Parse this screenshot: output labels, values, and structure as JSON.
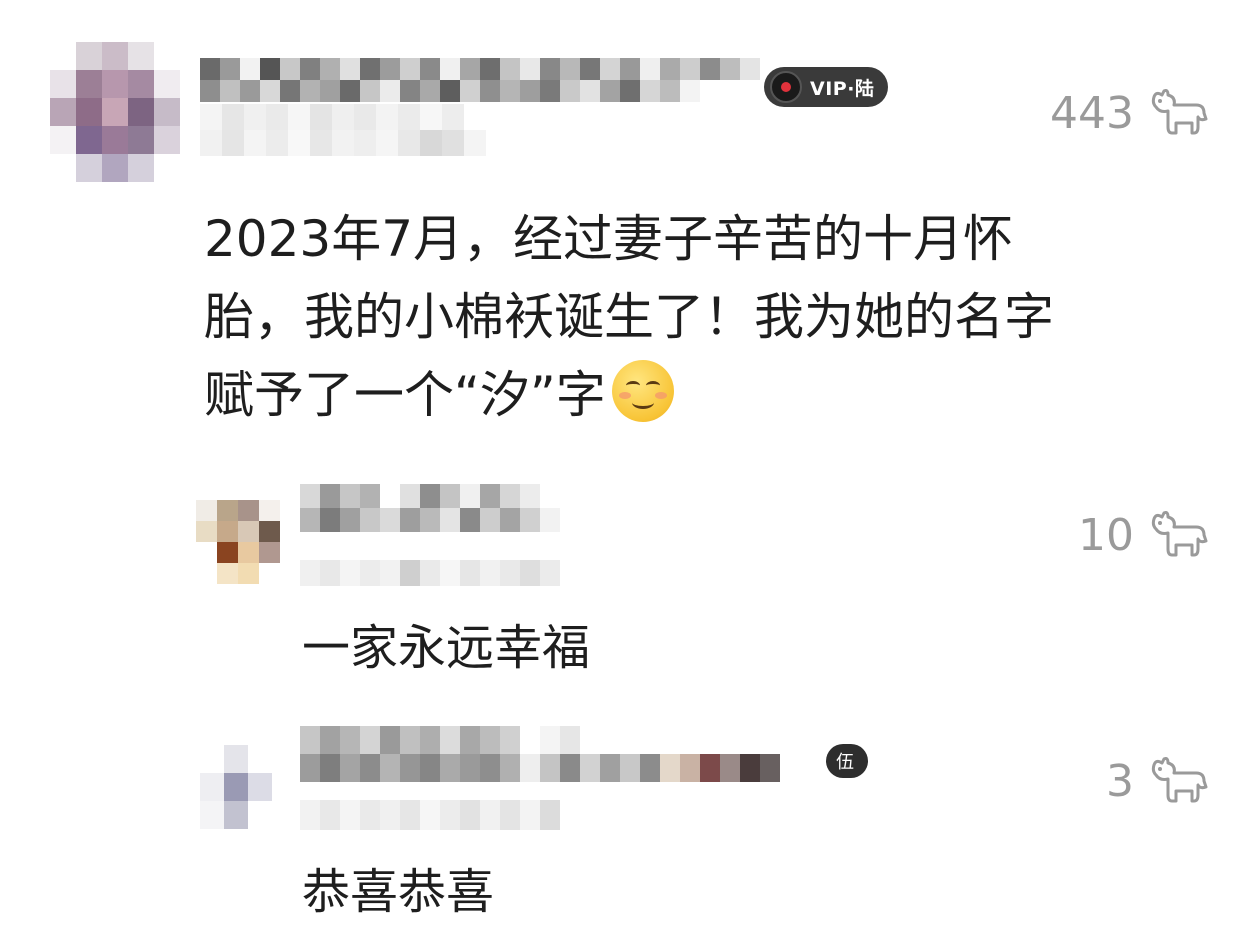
{
  "main_comment": {
    "vip_badge": "VIP·陆",
    "text_line1": "2023年7月，经过妻子辛苦的十月怀",
    "text_line2": "胎，我的小棉袄诞生了！我为她的名字",
    "text_line3": "赋予了一个“汐”字",
    "emoji": "smiling-face-emoji",
    "likes": "443"
  },
  "replies": [
    {
      "text": "一家永远幸福",
      "likes": "10"
    },
    {
      "tag": "伍",
      "text": "恭喜恭喜",
      "likes": "3"
    }
  ],
  "icons": {
    "like": "like-animal-icon"
  }
}
